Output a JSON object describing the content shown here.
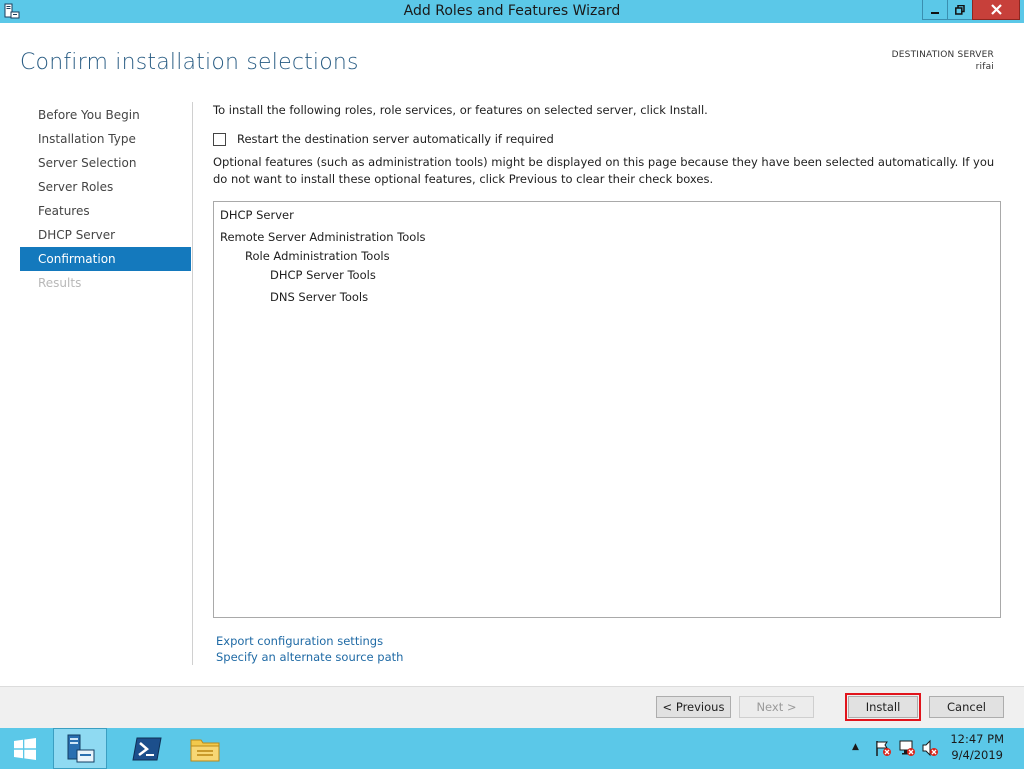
{
  "window": {
    "title": "Add Roles and Features Wizard"
  },
  "header": {
    "title": "Confirm installation selections",
    "destination_label": "DESTINATION SERVER",
    "destination_name": "rifai"
  },
  "nav": {
    "items": [
      {
        "label": "Before You Begin"
      },
      {
        "label": "Installation Type"
      },
      {
        "label": "Server Selection"
      },
      {
        "label": "Server Roles"
      },
      {
        "label": "Features"
      },
      {
        "label": "DHCP Server"
      },
      {
        "label": "Confirmation"
      },
      {
        "label": "Results"
      }
    ]
  },
  "content": {
    "intro": "To install the following roles, role services, or features on selected server, click Install.",
    "restart_label": "Restart the destination server automatically if required",
    "optional_note": "Optional features (such as administration tools) might be displayed on this page because they have been selected automatically. If you do not want to install these optional features, click Previous to clear their check boxes.",
    "selections": [
      {
        "label": "DHCP Server"
      },
      {
        "label": "Remote Server Administration Tools"
      },
      {
        "label": "Role Administration Tools"
      },
      {
        "label": "DHCP Server Tools"
      },
      {
        "label": "DNS Server Tools"
      }
    ],
    "export_link": "Export configuration settings",
    "source_link": "Specify an alternate source path"
  },
  "footer": {
    "previous": "< Previous",
    "next": "Next >",
    "install": "Install",
    "cancel": "Cancel"
  },
  "taskbar": {
    "time": "12:47 PM",
    "date": "9/4/2019"
  },
  "colors": {
    "accent": "#1479bd",
    "titlebar": "#5bc8e8",
    "highlight_outline": "#e1141c"
  }
}
